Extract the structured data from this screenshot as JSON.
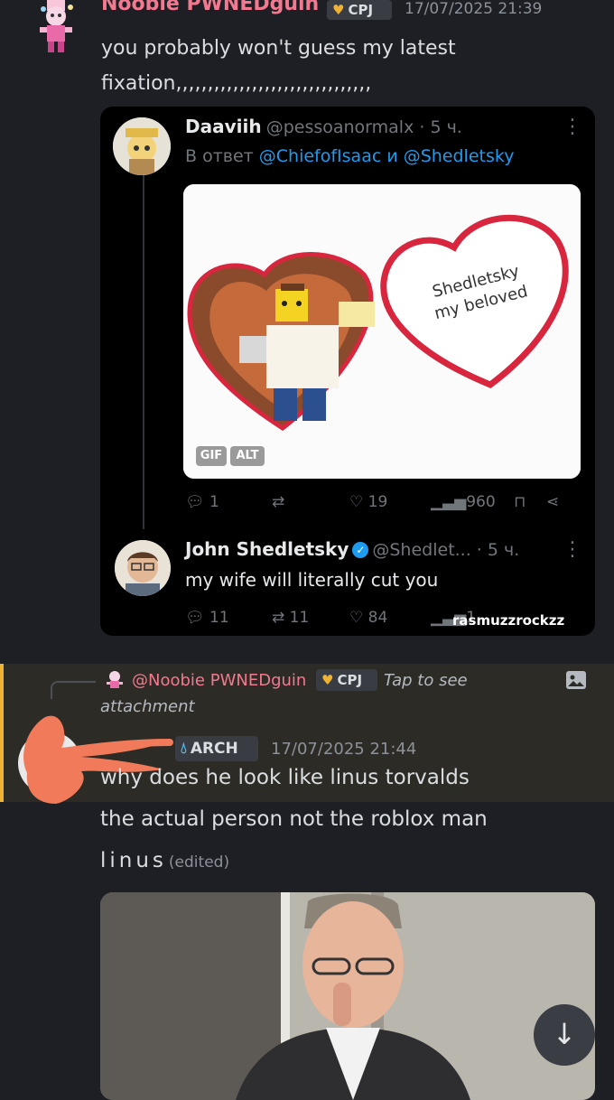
{
  "message1": {
    "author": "Noobie PWNEDguin",
    "clan_tag": "CPJ",
    "timestamp": "17/07/2025 21:39",
    "lines": [
      "you probably won't guess my latest",
      "fixation,,,,,,,,,,,,,,,,,,,,,,,,,,,,,,,"
    ]
  },
  "tweet1": {
    "name": "Daaviih",
    "handle": "@pessoanormalx · 5 ч.",
    "reply_prefix": "В ответ ",
    "reply_mentions": "@ChiefofIsaac и @Shedletsky",
    "gif_text_line1": "Shedletsky",
    "gif_text_line2": "my beloved",
    "badge_gif": "GIF",
    "badge_alt": "ALT",
    "replies": "1",
    "likes": "19",
    "views": "960"
  },
  "tweet2": {
    "name": "John Shedletsky",
    "handle": "@Shedlet... · 5 ч.",
    "text": "my wife will literally cut you",
    "replies": "11",
    "retweets": "11",
    "likes": "84",
    "views": "1.",
    "watermark": "rasmuzzrockzz"
  },
  "reply_ref": {
    "author": "@Noobie PWNEDguin",
    "clan_tag": "CPJ",
    "tap_text": "Tap to see",
    "tap_text2": "attachment"
  },
  "message2": {
    "clan_tag": "ARCH",
    "timestamp": "17/07/2025 21:44",
    "line1": "why does he look like linus torvalds",
    "line2": "the actual person not the roblox man",
    "line3": "linus",
    "edited": "(edited)"
  },
  "icons": {
    "scroll_down": "arrow-down-icon",
    "image": "image-icon",
    "heart": "heart-icon",
    "drop": "drop-icon"
  },
  "colors": {
    "background": "#1e1f24",
    "author": "#f2798f",
    "highlight": "#2d2b25",
    "highlight_bar": "#f0b232",
    "link": "#1d9bf0"
  }
}
